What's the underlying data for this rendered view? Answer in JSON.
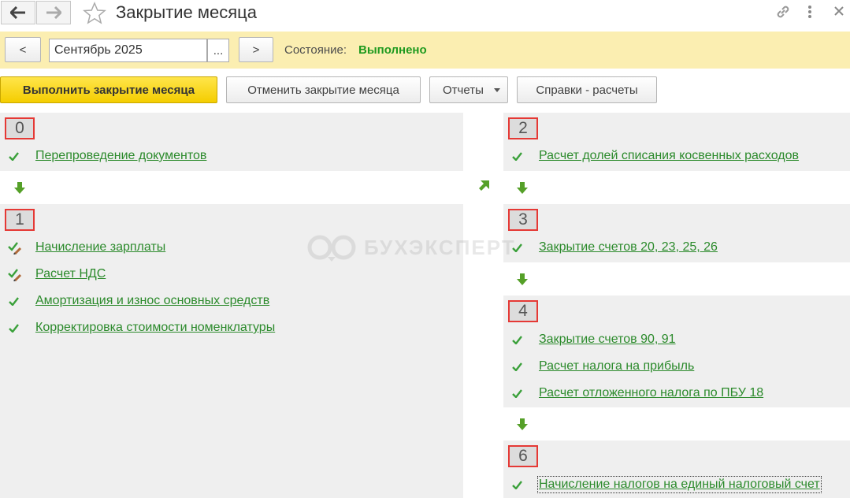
{
  "window": {
    "title": "Закрытие месяца",
    "icons": [
      "back-arrow-icon",
      "forward-arrow-icon",
      "star-icon",
      "link-icon",
      "more-vertical-icon",
      "close-icon"
    ]
  },
  "period": {
    "prev_label": "<",
    "value": "Сентябрь 2025",
    "choose_label": "...",
    "next_label": ">",
    "status_label": "Состояние:",
    "status_value": "Выполнено"
  },
  "toolbar": {
    "run": "Выполнить закрытие месяца",
    "cancel": "Отменить закрытие месяца",
    "reports": "Отчеты",
    "references": "Справки - расчеты"
  },
  "watermark": "БУХЭКСПЕРТ",
  "stages": {
    "s0": {
      "num": "0",
      "tasks": [
        "Перепроведение документов"
      ]
    },
    "s1": {
      "num": "1",
      "tasks": [
        "Начисление зарплаты",
        "Расчет НДС",
        "Амортизация и износ основных средств",
        "Корректировка стоимости номенклатуры"
      ]
    },
    "s2": {
      "num": "2",
      "tasks": [
        "Расчет долей списания косвенных расходов"
      ]
    },
    "s3": {
      "num": "3",
      "tasks": [
        "Закрытие счетов 20, 23, 25, 26"
      ]
    },
    "s4": {
      "num": "4",
      "tasks": [
        "Закрытие счетов 90, 91",
        "Расчет налога на прибыль",
        "Расчет отложенного налога по ПБУ 18"
      ]
    },
    "s6": {
      "num": "6",
      "tasks": [
        "Начисление налогов на единый налоговый счет"
      ]
    }
  },
  "colors": {
    "accent_yellow": "#f4cd00",
    "period_bar": "#fbeeb1",
    "status_green": "#1f9a1f",
    "link_green": "#2b8a2b",
    "highlight_red": "#e53935"
  }
}
